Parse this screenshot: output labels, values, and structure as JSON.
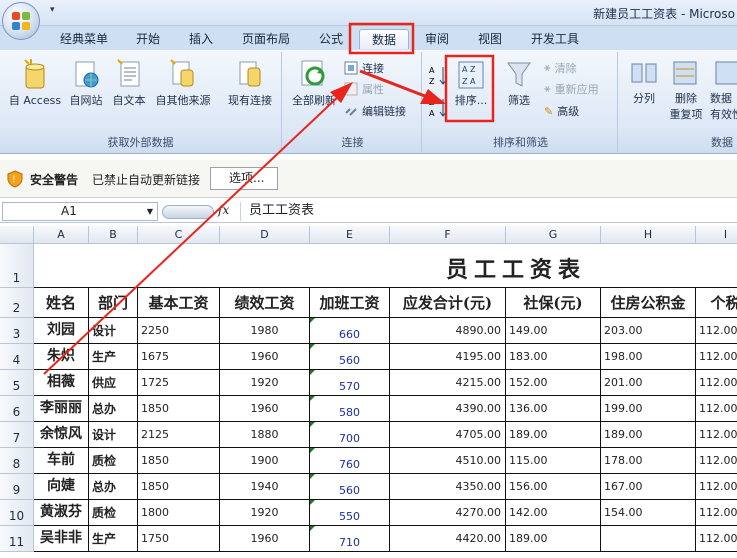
{
  "window": {
    "title": "新建员工工资表 - Microso"
  },
  "tabs": [
    "经典菜单",
    "开始",
    "插入",
    "页面布局",
    "公式",
    "数据",
    "审阅",
    "视图",
    "开发工具"
  ],
  "ribbon": {
    "external": {
      "access": "自 Access",
      "web": "自网站",
      "text": "自文本",
      "other": "自其他来源",
      "existing": "现有连接",
      "group": "获取外部数据"
    },
    "connections": {
      "refresh": "全部刷新",
      "connect": "连接",
      "props": "属性",
      "edit_links": "编辑链接",
      "group": "连接"
    },
    "sort": {
      "sort": "排序...",
      "filter": "筛选",
      "clear": "清除",
      "reapply": "重新应用",
      "advanced": "高级",
      "group": "排序和筛选"
    },
    "tools": {
      "split": "分列",
      "dedupe_1": "删除",
      "dedupe_2": "重复项",
      "valid_1": "数据",
      "valid_2": "有效性",
      "group": "数据"
    }
  },
  "security": {
    "title": "安全警告",
    "message": "已禁止自动更新链接",
    "options": "选项..."
  },
  "formula": {
    "cell": "A1",
    "fx": "fx",
    "content": "员工工资表"
  },
  "grid": {
    "columns": [
      "A",
      "B",
      "C",
      "D",
      "E",
      "F",
      "G",
      "H",
      "I"
    ],
    "rows": [
      "1",
      "2",
      "3",
      "4",
      "5",
      "6",
      "7",
      "8",
      "9",
      "10",
      "11"
    ],
    "title": "员工工资表",
    "headers": [
      "姓名",
      "部门",
      "基本工资",
      "绩效工资",
      "加班工资",
      "应发合计(元)",
      "社保(元)",
      "住房公积金",
      "个税"
    ],
    "data": [
      [
        "刘园",
        "设计",
        "2250",
        "1980",
        "660",
        "4890.00",
        "149.00",
        "203.00",
        "112.00"
      ],
      [
        "朱炽",
        "生产",
        "1675",
        "1960",
        "560",
        "4195.00",
        "183.00",
        "198.00",
        "112.00"
      ],
      [
        "相薇",
        "供应",
        "1725",
        "1920",
        "570",
        "4215.00",
        "152.00",
        "201.00",
        "112.00"
      ],
      [
        "李丽丽",
        "总办",
        "1850",
        "1960",
        "580",
        "4390.00",
        "136.00",
        "199.00",
        "112.00"
      ],
      [
        "余惊风",
        "设计",
        "2125",
        "1880",
        "700",
        "4705.00",
        "189.00",
        "189.00",
        "112.00"
      ],
      [
        "车前",
        "质检",
        "1850",
        "1900",
        "760",
        "4510.00",
        "115.00",
        "178.00",
        "112.00"
      ],
      [
        "向婕",
        "总办",
        "1850",
        "1940",
        "560",
        "4350.00",
        "156.00",
        "167.00",
        "112.00"
      ],
      [
        "黄淑芬",
        "质检",
        "1800",
        "1920",
        "550",
        "4270.00",
        "142.00",
        "154.00",
        "112.00"
      ],
      [
        "吴非非",
        "生产",
        "1750",
        "1960",
        "710",
        "4420.00",
        "189.00",
        "",
        "112.00"
      ]
    ]
  },
  "colors": {
    "highlight_box": "#e8251c",
    "arrow": "#e8251c"
  }
}
